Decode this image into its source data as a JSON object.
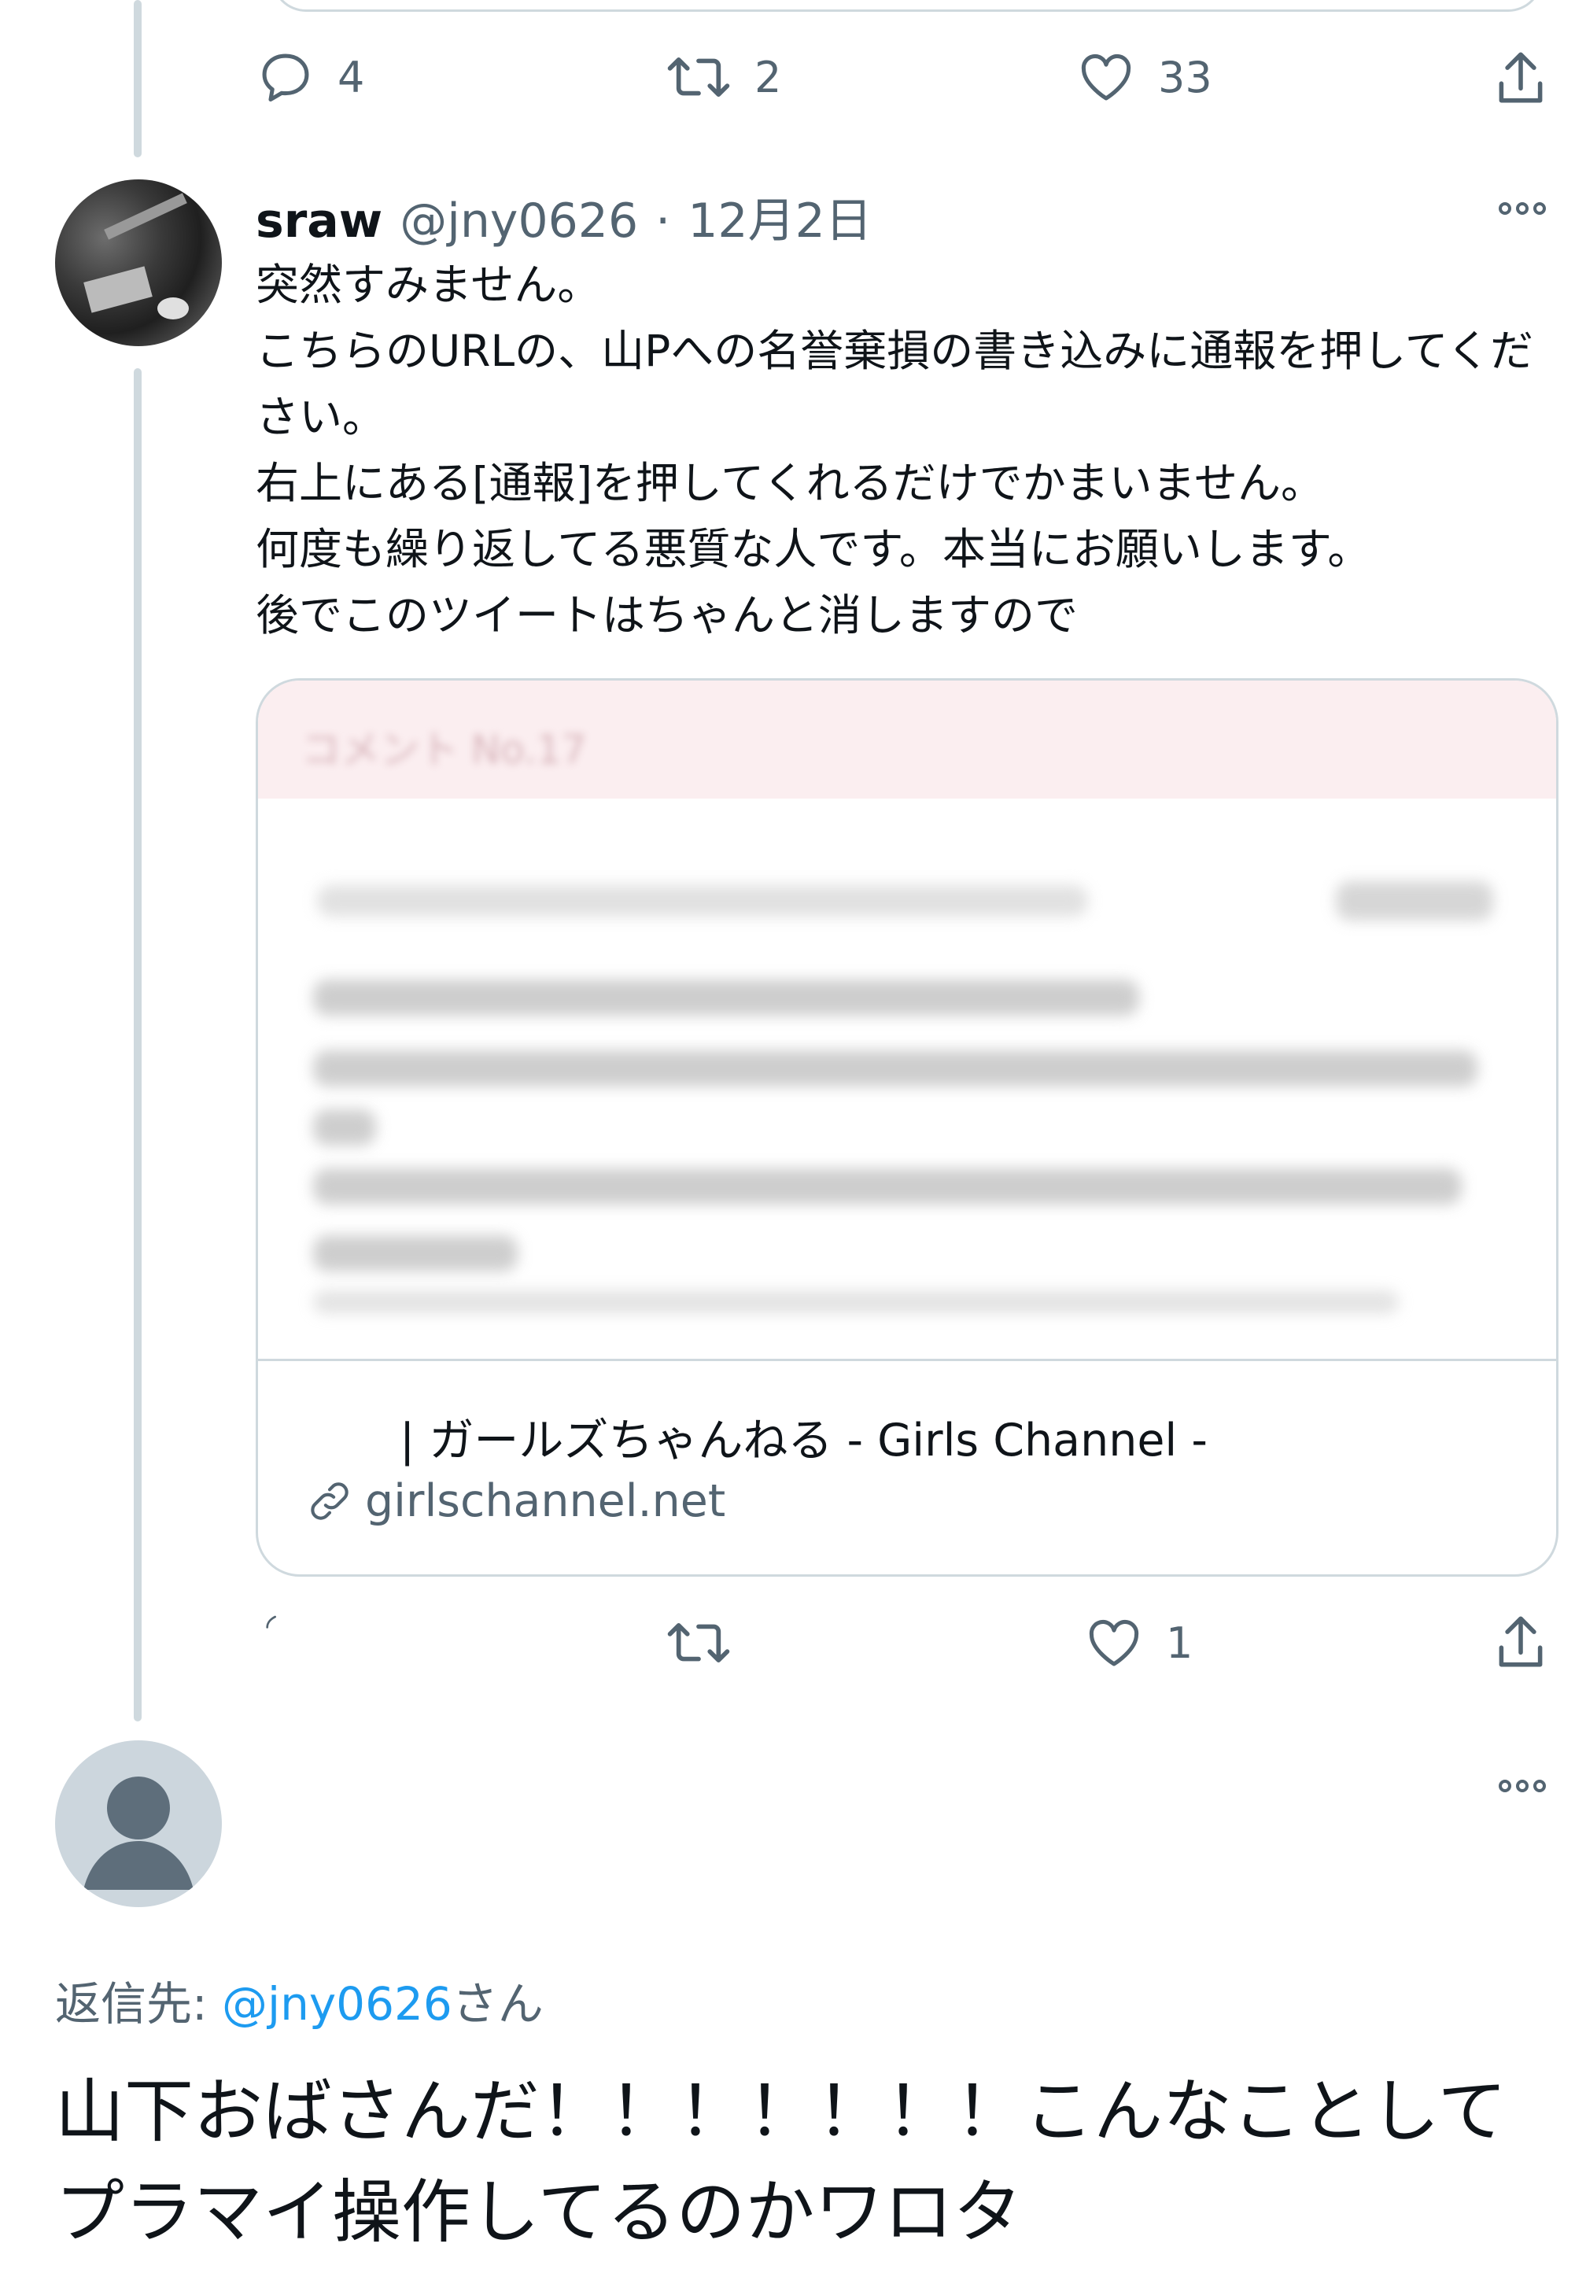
{
  "top_tweet": {
    "actions": {
      "reply_count": "4",
      "retweet_count": "2",
      "like_count": "33"
    }
  },
  "tweet": {
    "display_name": "sraw",
    "handle": "@jny0626",
    "separator": "·",
    "date": "12月2日",
    "text": "突然すみません。\nこちらのURLの、山Pへの名誉棄損の書き込みに通報を押してください。\n右上にある[通報]を押してくれるだけでかまいません。\n何度も繰り返してる悪質な人です。本当にお願いします。\n後でこのツイートはちゃんと消しますので",
    "card": {
      "header_blurred": "コメント No.17",
      "title": "| ガールズちゃんねる - Girls Channel -",
      "domain": "girlschannel.net"
    },
    "actions": {
      "like_count": "1"
    }
  },
  "reply": {
    "reply_to_label": "返信先:",
    "reply_to_mention": "@jny0626",
    "reply_to_suffix": "さん",
    "text": "山下おばさんだ！！！！！！！こんなことしてプラマイ操作してるのかワロタ"
  },
  "icons": [
    "reply-icon",
    "retweet-icon",
    "like-icon",
    "share-icon",
    "more-icon",
    "link-icon",
    "default-avatar-icon"
  ],
  "colors": {
    "text_primary": "#0f1419",
    "text_secondary": "#536471",
    "mention_blue": "#1d9bf0",
    "border": "#cfd9de",
    "card_header_pink": "#fbeef0"
  }
}
